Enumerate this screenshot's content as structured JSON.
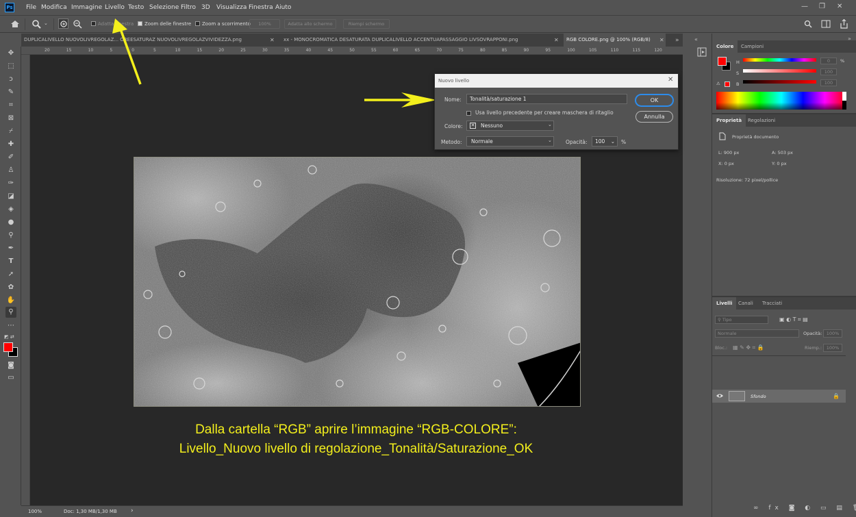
{
  "menubar": {
    "logo": "Ps",
    "items": [
      "File",
      "Modifica",
      "Immagine",
      "Livello",
      "Testo",
      "Selezione",
      "Filtro",
      "3D",
      "Visualizza",
      "Finestra",
      "Aiuto"
    ],
    "window_controls": {
      "minimize": "—",
      "restore": "❐",
      "close": "✕"
    }
  },
  "options": {
    "fit_window": "Adatta finestra",
    "zoom_windows": "Zoom delle finestre",
    "scrubby_zoom": "Zoom a scorrimento",
    "zoom_value": "100%",
    "fit_screen": "Adatta allo schermo",
    "fill_screen": "Riempi schermo"
  },
  "tabs": [
    {
      "label": "DUPLICALIVELLO NUOVOLIVREGOLAZ... OREESATURAZ NUOVOLIVREGOLAZVIVIDEZZA.png",
      "close": "✕"
    },
    {
      "label": "xx - MONOCROMATICA DESATURATA DUPLICALIVELLO ACCENTUAPASSAGGIO LIVSOVRAPPONI.png",
      "close": "✕"
    },
    {
      "label": "RGB COLORE.png @ 100% (RGB/8)",
      "close": "✕"
    }
  ],
  "ruler_top": [
    "20",
    "15",
    "10",
    "5",
    "0",
    "5",
    "10",
    "15",
    "20",
    "25",
    "30",
    "35",
    "40",
    "45",
    "50",
    "55",
    "60",
    "65",
    "70",
    "75",
    "80",
    "85",
    "90",
    "95",
    "100",
    "105",
    "110",
    "115",
    "120"
  ],
  "dialog": {
    "title": "Nuovo livello",
    "close": "✕",
    "name_label": "Nome:",
    "name_value": "Tonalità/saturazione 1",
    "use_prev_label": "Usa livello precedente per creare maschera di ritaglio",
    "color_label": "Colore:",
    "color_value": "Nessuno",
    "mode_label": "Metodo:",
    "mode_value": "Normale",
    "opacity_label": "Opacità:",
    "opacity_value": "100",
    "opacity_unit": "%",
    "ok": "OK",
    "cancel": "Annulla"
  },
  "caption": {
    "line1": "Dalla cartella “RGB” aprire l’immagine “RGB-COLORE”:",
    "line2": "Livello_Nuovo livello di regolazione_Tonalità/Saturazione_OK"
  },
  "status": {
    "zoom": "100%",
    "doc": "Doc: 1,30 MB/1,30 MB",
    "arrow": "›"
  },
  "color_panel": {
    "tabs": [
      "Colore",
      "Campioni"
    ],
    "h_label": "H",
    "s_label": "S",
    "b_label": "B",
    "h_value": "0",
    "s_value": "100",
    "b_value": "100",
    "foreground": "#ff0000",
    "background": "#000000"
  },
  "properties_panel": {
    "tabs": [
      "Proprietà",
      "Regolazioni"
    ],
    "doc_title": "Proprietà documento",
    "w": "L: 900 px",
    "h": "A: 503 px",
    "x": "X: 0 px",
    "y": "Y: 0 px",
    "resolution": "Risoluzione: 72 pixel/pollice"
  },
  "layers_panel": {
    "tabs": [
      "Livelli",
      "Canali",
      "Tracciati"
    ],
    "filter": "Tipo",
    "blend": "Normale",
    "opacity_label": "Opacità:",
    "opacity_value": "100%",
    "lock_label": "Bloc.:",
    "fill_label": "Riemp.:",
    "fill_value": "100%",
    "layer_name": "Sfondo"
  },
  "accent": {
    "arrow": "#f3ef1c",
    "highlight": "#2d8ceb"
  }
}
